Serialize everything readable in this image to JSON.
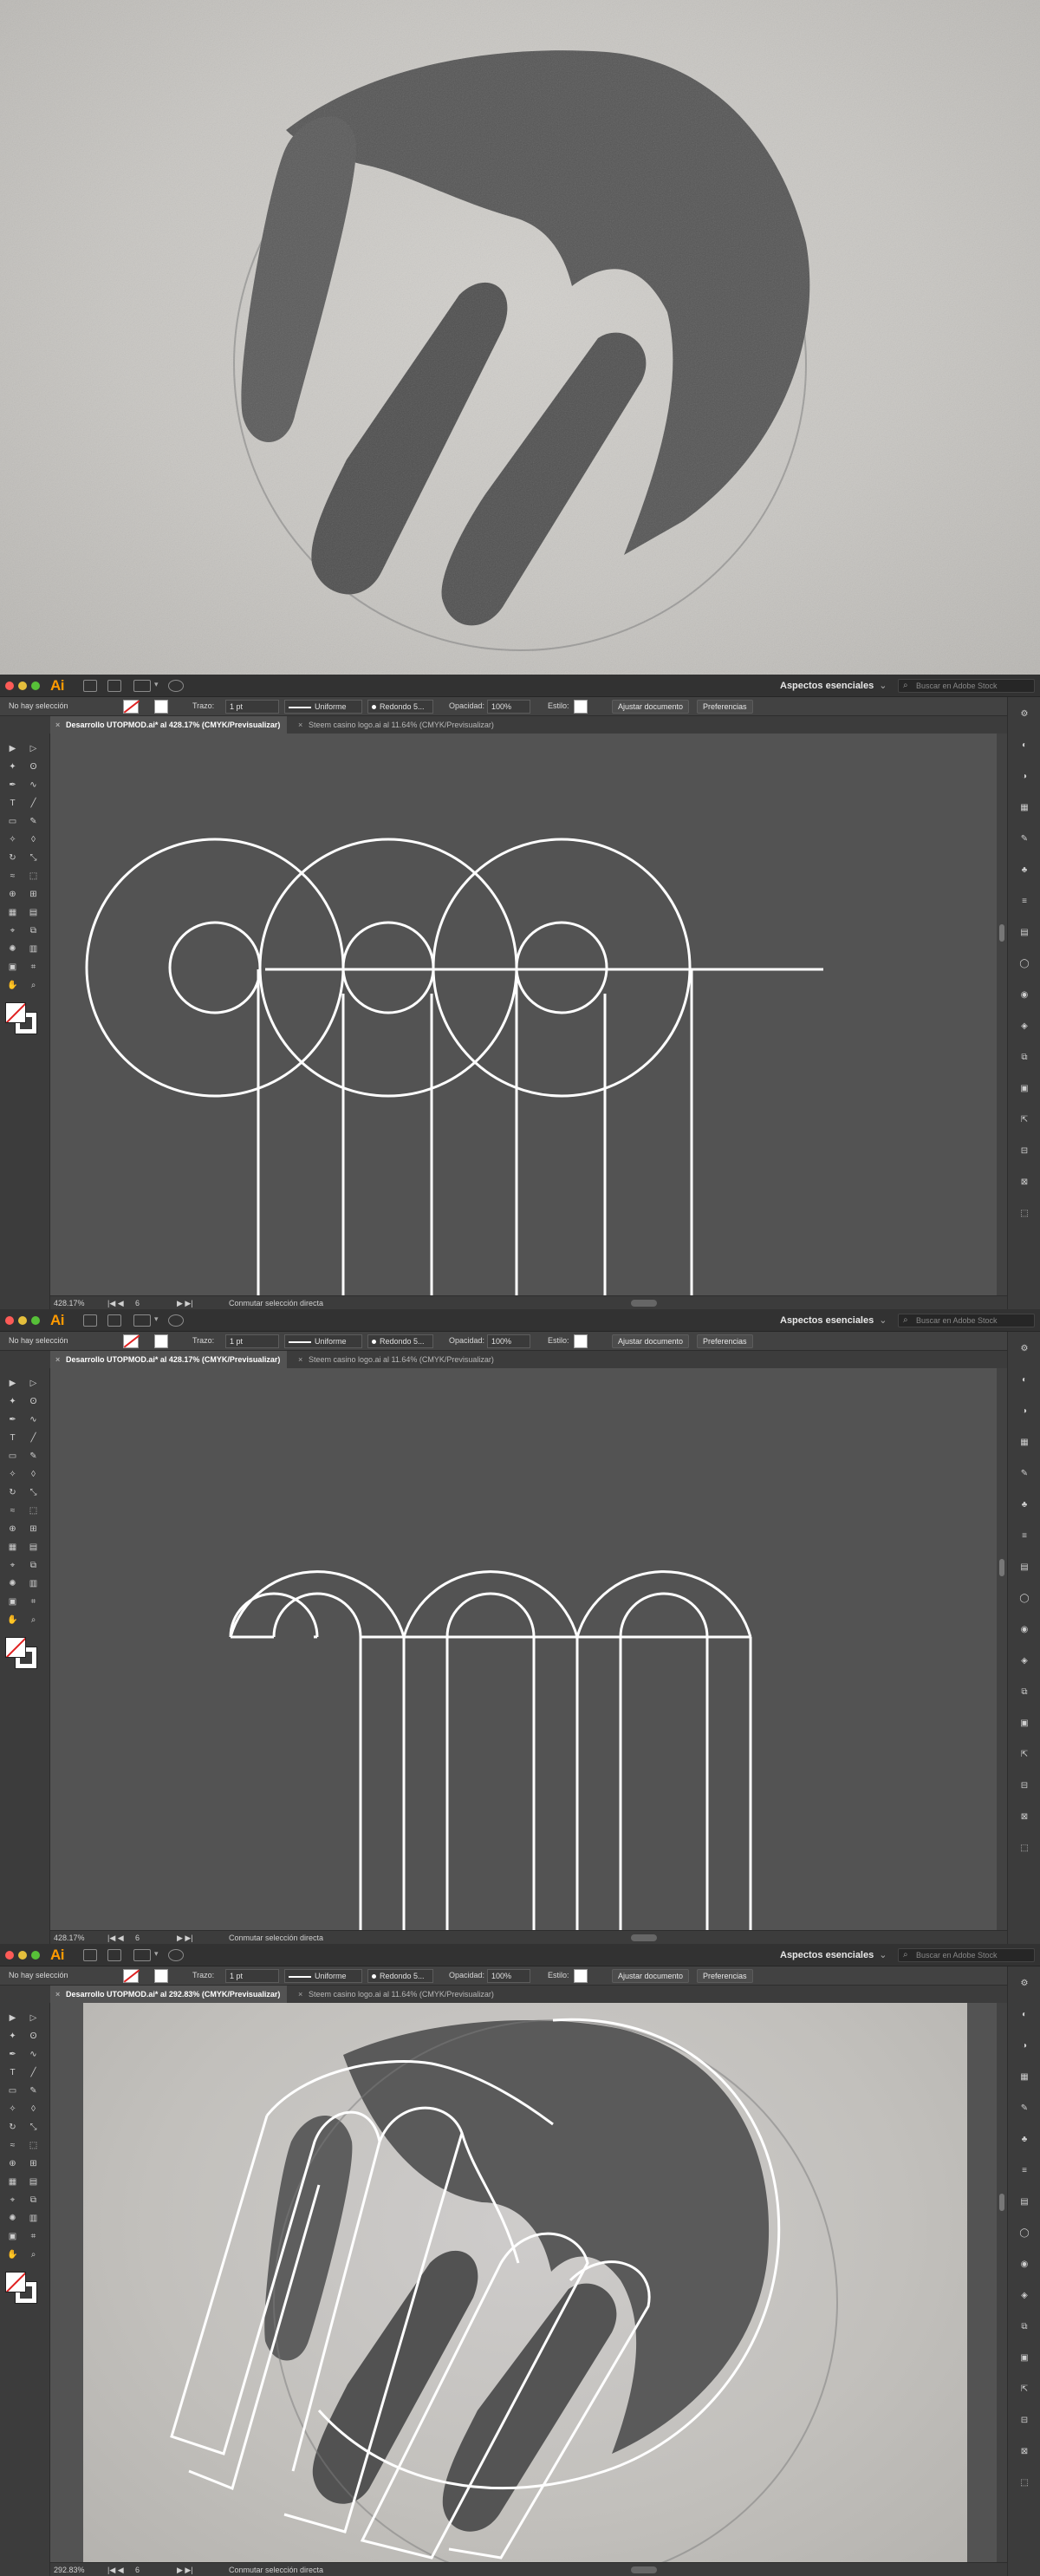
{
  "app": {
    "logo": "Ai",
    "workspace": "Aspectos esenciales",
    "search_placeholder": "Buscar en Adobe Stock"
  },
  "control_bar": {
    "selection": "No hay selección",
    "stroke_label": "Trazo:",
    "stroke_weight": "1 pt",
    "profile": "Uniforme",
    "brush": "Redondo 5...",
    "opacity_label": "Opacidad:",
    "opacity_value": "100%",
    "style_label": "Estilo:",
    "fit_document": "Ajustar documento",
    "preferences": "Preferencias"
  },
  "windows": [
    {
      "tab_active": "Desarrollo UTOPMOD.ai* al 428.17% (CMYK/Previsualizar)",
      "tab_inactive": "Steem casino logo.ai al 11.64% (CMYK/Previsualizar)",
      "zoom": "428.17%",
      "page": "6",
      "status": "Conmutar selección directa"
    },
    {
      "tab_active": "Desarrollo UTOPMOD.ai* al 428.17% (CMYK/Previsualizar)",
      "tab_inactive": "Steem casino logo.ai al 11.64% (CMYK/Previsualizar)",
      "zoom": "428.17%",
      "page": "6",
      "status": "Conmutar selección directa"
    },
    {
      "tab_active": "Desarrollo UTOPMOD.ai* al 292.83% (CMYK/Previsualizar)",
      "tab_inactive": "Steem casino logo.ai al 11.64% (CMYK/Previsualizar)",
      "zoom": "292.83%",
      "page": "6",
      "status": "Conmutar selección directa"
    }
  ],
  "colors": {
    "chrome_dark": "#323232",
    "panel": "#3c3c3c",
    "canvas": "#535353",
    "ai_orange": "#ff9a00",
    "paper": "#c8c6c2",
    "line": "#ffffff"
  },
  "icons": {
    "tools": [
      "selection-tool-icon",
      "direct-selection-tool-icon",
      "magic-wand-icon",
      "lasso-icon",
      "pen-tool-icon",
      "curvature-icon",
      "type-tool-icon",
      "line-tool-icon",
      "rectangle-tool-icon",
      "paintbrush-icon",
      "shaper-icon",
      "eraser-icon",
      "rotate-icon",
      "scale-icon",
      "warp-icon",
      "free-transform-icon",
      "shape-builder-icon",
      "perspective-icon",
      "mesh-icon",
      "gradient-icon",
      "eyedropper-icon",
      "blend-icon",
      "symbol-sprayer-icon",
      "graph-icon",
      "artboard-icon",
      "slice-icon",
      "hand-icon",
      "zoom-icon"
    ],
    "panels": [
      "properties-icon",
      "color-icon",
      "color-guide-icon",
      "swatches-icon",
      "brushes-icon",
      "symbols-icon",
      "stroke-icon",
      "gradient-panel-icon",
      "transparency-icon",
      "appearance-icon",
      "graphic-styles-icon",
      "layers-icon",
      "artboards-icon",
      "asset-export-icon",
      "align-icon",
      "pathfinder-icon",
      "transform-icon"
    ]
  }
}
